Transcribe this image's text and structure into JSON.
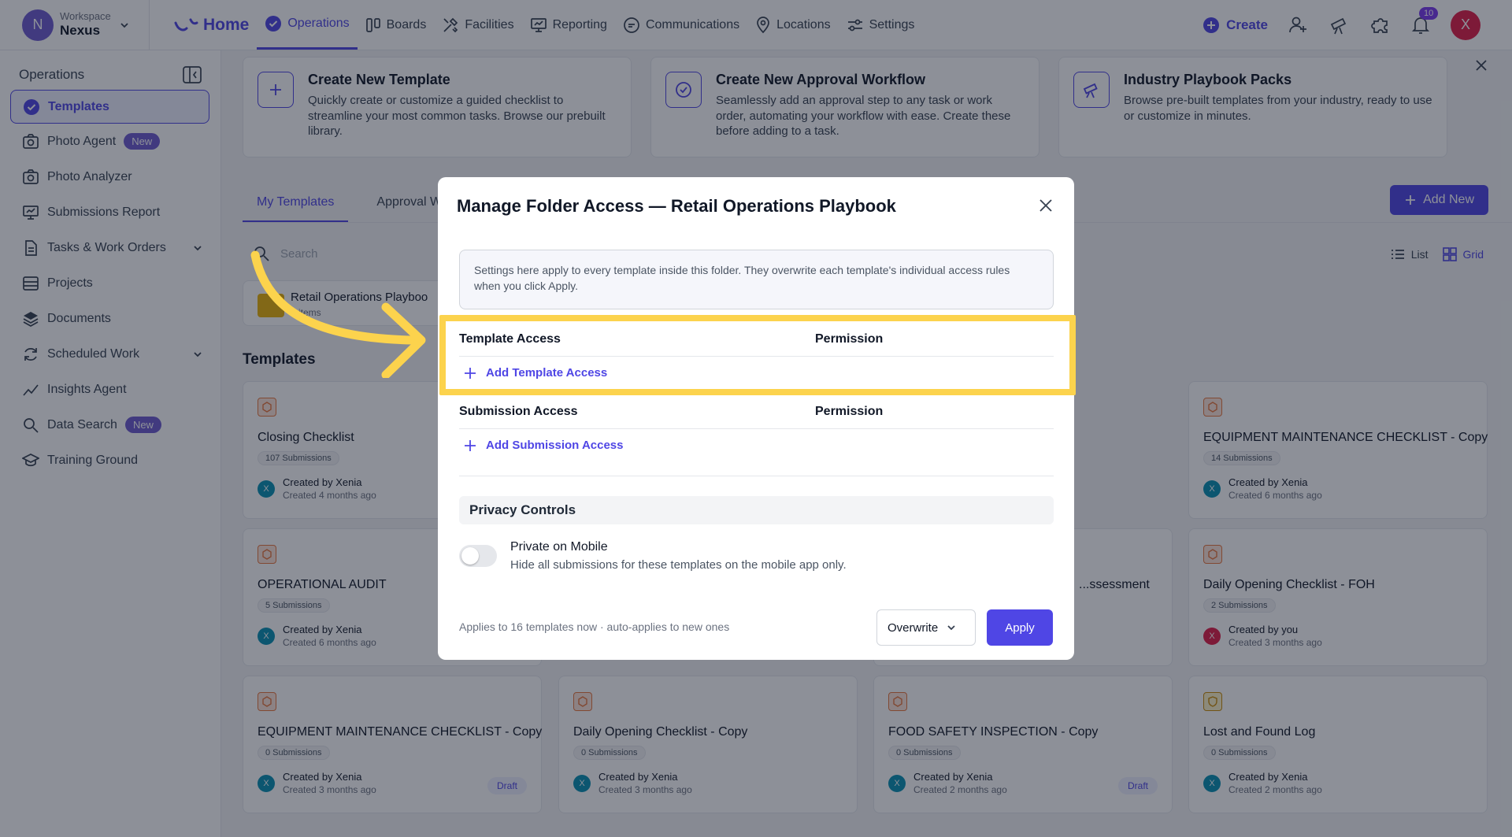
{
  "topbar": {
    "workspace_initial": "N",
    "workspace_label": "Workspace",
    "workspace_name": "Nexus",
    "home_label": "Home",
    "nav": [
      {
        "label": "Operations"
      },
      {
        "label": "Boards"
      },
      {
        "label": "Facilities"
      },
      {
        "label": "Reporting"
      },
      {
        "label": "Communications"
      },
      {
        "label": "Locations"
      },
      {
        "label": "Settings"
      }
    ],
    "create_label": "Create",
    "notification_count": "10",
    "user_initial": "X"
  },
  "sidebar": {
    "title": "Operations",
    "items": [
      {
        "label": "Templates"
      },
      {
        "label": "Photo Agent",
        "badge": "New"
      },
      {
        "label": "Photo Analyzer"
      },
      {
        "label": "Submissions Report"
      },
      {
        "label": "Tasks & Work Orders"
      },
      {
        "label": "Projects"
      },
      {
        "label": "Documents"
      },
      {
        "label": "Scheduled Work"
      },
      {
        "label": "Insights Agent"
      },
      {
        "label": "Data Search",
        "badge": "New"
      },
      {
        "label": "Training Ground"
      }
    ]
  },
  "promos": [
    {
      "title": "Create New Template",
      "desc": "Quickly create or customize a guided checklist to streamline your most common tasks. Browse our prebuilt library."
    },
    {
      "title": "Create New Approval Workflow",
      "desc": "Seamlessly add an approval step to any task or work order, automating your workflow with ease. Create these before adding to a task."
    },
    {
      "title": "Industry Playbook Packs",
      "desc": "Browse pre-built templates from your industry, ready to use or customize in minutes."
    }
  ],
  "main": {
    "tabs": [
      "My Templates",
      "Approval Wo"
    ],
    "add_new_label": "Add New",
    "view_list": "List",
    "view_grid": "Grid",
    "search_placeholder": "Search",
    "folder_name": "Retail Operations Playboo",
    "folder_meta": "...items",
    "templates_title": "Templates"
  },
  "templates": [
    {
      "name": "Closing Checklist",
      "subs": "107 Submissions",
      "by": "Created by Xenia",
      "ago": "Created 4 months ago",
      "av": "X"
    },
    {
      "name": "EQUIPMENT MAINTENANCE CHECKLIST - Copy",
      "subs": "14 Submissions",
      "by": "Created by Xenia",
      "ago": "Created 6 months ago",
      "av": "X"
    },
    {
      "name": "OPERATIONAL AUDIT",
      "subs": "5 Submissions",
      "by": "Created by Xenia",
      "ago": "Created 6 months ago",
      "av": "X"
    },
    {
      "name": "...ssessment",
      "subs": "",
      "by": "",
      "ago": "",
      "av": ""
    },
    {
      "name": "Daily Opening Checklist - FOH",
      "subs": "2 Submissions",
      "by": "Created by you",
      "ago": "Created 3 months ago",
      "av": "X"
    },
    {
      "name": "EQUIPMENT MAINTENANCE CHECKLIST - Copy",
      "subs": "0 Submissions",
      "by": "Created by Xenia",
      "ago": "Created 3 months ago",
      "av": "X",
      "draft": "Draft"
    },
    {
      "name": "Daily Opening Checklist - Copy",
      "subs": "0 Submissions",
      "by": "Created by Xenia",
      "ago": "Created 3 months ago",
      "av": "X"
    },
    {
      "name": "FOOD SAFETY INSPECTION - Copy",
      "subs": "0 Submissions",
      "by": "Created by Xenia",
      "ago": "Created 2 months ago",
      "av": "X",
      "draft": "Draft"
    },
    {
      "name": "Lost and Found Log",
      "subs": "0 Submissions",
      "by": "Created by Xenia",
      "ago": "Created 2 months ago",
      "av": "X"
    }
  ],
  "modal": {
    "title": "Manage Folder Access — Retail Operations Playbook",
    "info": "Settings here apply to every template inside this folder. They overwrite each template's individual access rules when you click Apply.",
    "template_access_label": "Template Access",
    "permission_label": "Permission",
    "add_template_access": "Add Template Access",
    "submission_access_label": "Submission Access",
    "add_submission_access": "Add Submission Access",
    "privacy_title": "Privacy Controls",
    "toggle_title": "Private on Mobile",
    "toggle_desc": "Hide all submissions for these templates on the mobile app only.",
    "toggle_on": false,
    "footer_note": "Applies to 16 templates now · auto-applies to new ones",
    "mode_value": "Overwrite",
    "apply_label": "Apply"
  },
  "colors": {
    "accent": "#4f46e5",
    "highlight": "#fcd34d"
  }
}
